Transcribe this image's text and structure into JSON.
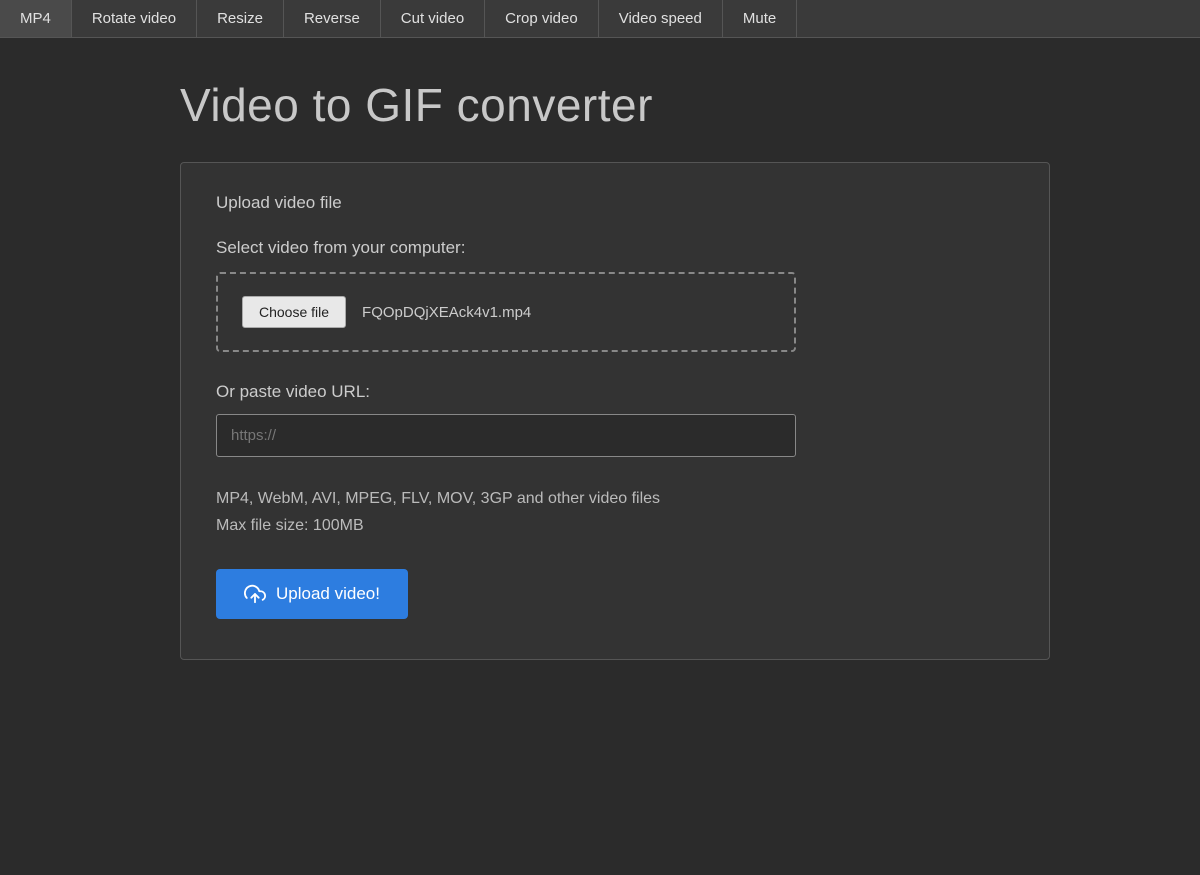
{
  "nav": {
    "items": [
      {
        "label": "MP4"
      },
      {
        "label": "Rotate video"
      },
      {
        "label": "Resize"
      },
      {
        "label": "Reverse"
      },
      {
        "label": "Cut video"
      },
      {
        "label": "Crop video"
      },
      {
        "label": "Video speed"
      },
      {
        "label": "Mute"
      }
    ]
  },
  "page": {
    "title": "Video to GIF converter"
  },
  "upload_card": {
    "card_title": "Upload video file",
    "file_section_label": "Select video from your computer:",
    "choose_file_btn": "Choose file",
    "file_name": "FQOpDQjXEAck4v1.mp4",
    "url_label": "Or paste video URL:",
    "url_placeholder": "https://",
    "formats_line1": "MP4, WebM, AVI, MPEG, FLV, MOV, 3GP and other video files",
    "formats_line2": "Max file size: 100MB",
    "upload_btn": "Upload video!"
  }
}
